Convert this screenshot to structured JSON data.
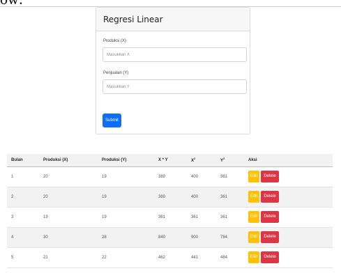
{
  "page_fragment": "ow:",
  "form": {
    "title": "Regresi Linear",
    "x_label": "Produksi (X)",
    "x_placeholder": "Masukkan X",
    "y_label": "Penjualan (Y)",
    "y_placeholder": "Masukkan Y",
    "submit_label": "Submit"
  },
  "table": {
    "headers": {
      "bulan": "Bulan",
      "x": "Produksi (X)",
      "y": "Produksi (Y)",
      "xy": "X * Y",
      "x2_base": "X",
      "x2_sup": "2",
      "y2_base": "Y",
      "y2_sup": "2",
      "aksi": "Aksi"
    },
    "edit_label": "Edit",
    "delete_label": "Delete",
    "rows": [
      {
        "bulan": "1",
        "x": "20",
        "y": "19",
        "xy": "380",
        "x2": "400",
        "y2": "361"
      },
      {
        "bulan": "2",
        "x": "20",
        "y": "19",
        "xy": "380",
        "x2": "400",
        "y2": "361"
      },
      {
        "bulan": "3",
        "x": "19",
        "y": "19",
        "xy": "361",
        "x2": "361",
        "y2": "361"
      },
      {
        "bulan": "4",
        "x": "30",
        "y": "28",
        "xy": "840",
        "x2": "900",
        "y2": "784"
      },
      {
        "bulan": "5",
        "x": "21",
        "y": "22",
        "xy": "462",
        "x2": "441",
        "y2": "484"
      }
    ]
  },
  "colors": {
    "submit": "#0d6efd",
    "edit": "#ffc107",
    "delete": "#dc3545",
    "header_bg": "#f2f2f2"
  }
}
